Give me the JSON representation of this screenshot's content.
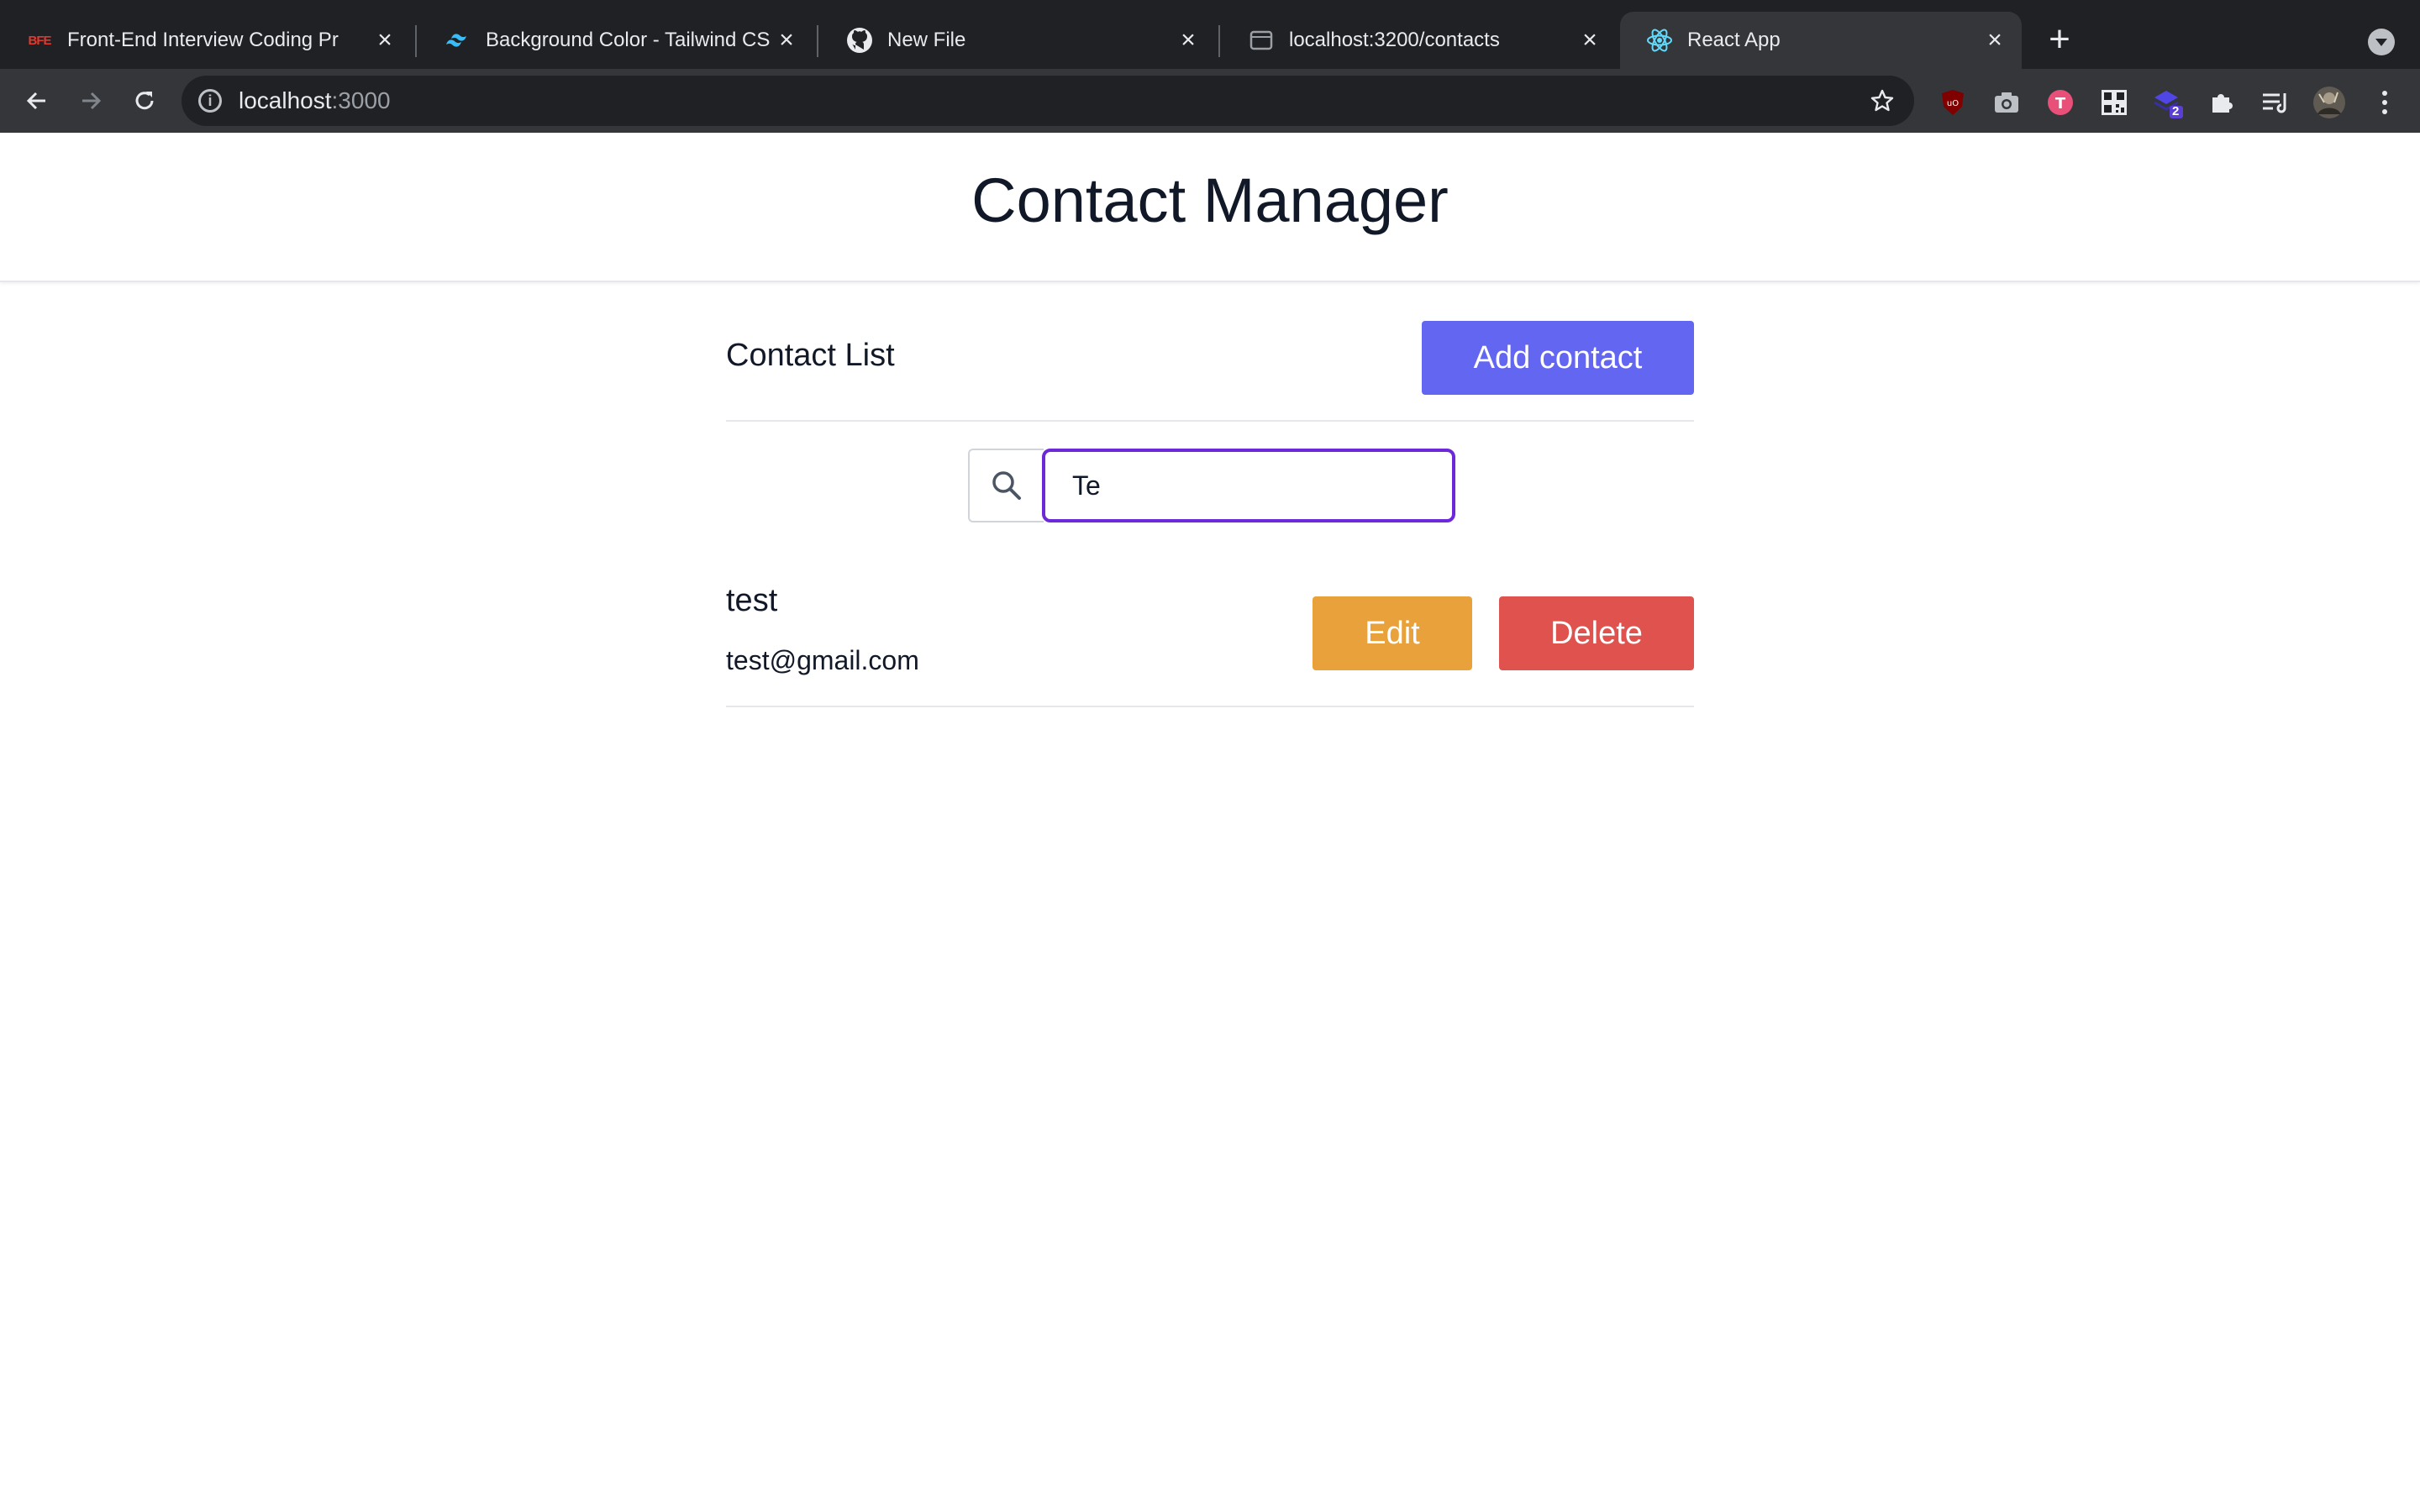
{
  "browser": {
    "tabs": [
      {
        "title": "Front-End Interview Coding Pr",
        "favicon": "bfe-icon"
      },
      {
        "title": "Background Color - Tailwind CS",
        "favicon": "tailwind-icon"
      },
      {
        "title": "New File",
        "favicon": "github-icon"
      },
      {
        "title": "localhost:3200/contacts",
        "favicon": "globe-icon"
      },
      {
        "title": "React App",
        "favicon": "react-icon"
      }
    ],
    "favicon_bfe_text": "BFE",
    "active_tab_index": 4,
    "address": {
      "host": "localhost",
      "port": ":3000"
    },
    "extension_badge": "2",
    "colors": {
      "tabstrip": "#202124",
      "toolbar": "#35363a"
    }
  },
  "app": {
    "title": "Contact Manager",
    "list_title": "Contact List",
    "add_button": "Add contact",
    "search": {
      "value": "Te",
      "icon": "search-icon"
    },
    "contacts": [
      {
        "name": "test",
        "email": "test@gmail.com",
        "edit_label": "Edit",
        "delete_label": "Delete"
      }
    ],
    "colors": {
      "primary": "#6366f1",
      "edit": "#e9a23b",
      "delete": "#e0524e",
      "focus_ring": "#6d28d9"
    }
  }
}
